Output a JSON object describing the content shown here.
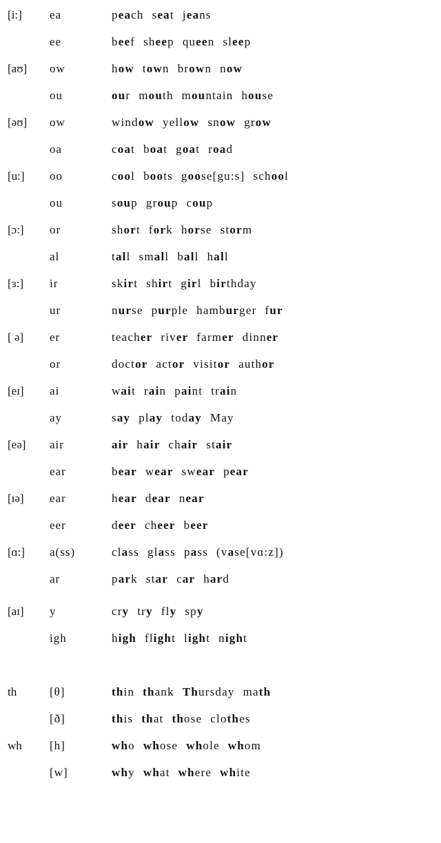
{
  "vowels": [
    {
      "ipa": "[i:]",
      "spelling": "ea",
      "bold": "ea",
      "words": [
        "peach",
        "seat",
        "jeans"
      ]
    },
    {
      "ipa": "",
      "spelling": "ee",
      "bold": "ee",
      "words": [
        "beef",
        "sheep",
        "queen",
        "sleep"
      ]
    },
    {
      "ipa": "[aʊ]",
      "spelling": "ow",
      "bold": "ow",
      "words": [
        "how",
        "town",
        "brown",
        "now"
      ]
    },
    {
      "ipa": "",
      "spelling": "ou",
      "bold": "ou",
      "words": [
        "our",
        "mouth",
        "mountain",
        "house"
      ]
    },
    {
      "ipa": "[əʊ]",
      "spelling": "ow",
      "bold": "ow",
      "words": [
        "window",
        "yellow",
        "snow",
        "grow"
      ]
    },
    {
      "ipa": "",
      "spelling": "oa",
      "bold": "oa",
      "words": [
        "coat",
        "boat",
        "goat",
        "road"
      ]
    },
    {
      "ipa": "[u:]",
      "spelling": "oo",
      "bold": "oo",
      "words": [
        "cool",
        "boots",
        "goose[gu:s]",
        "school"
      ]
    },
    {
      "ipa": "",
      "spelling": "ou",
      "bold": "ou",
      "words": [
        "soup",
        "group",
        "coup"
      ]
    },
    {
      "ipa": "[ɔ:]",
      "spelling": "or",
      "bold": "or",
      "words": [
        "short",
        "fork",
        "horse",
        "storm"
      ]
    },
    {
      "ipa": "",
      "spelling": "al",
      "bold": "al",
      "words": [
        "tall",
        "small",
        "ball",
        "hall"
      ]
    },
    {
      "ipa": "[ɜ:]",
      "spelling": "ir",
      "bold": "ir",
      "words": [
        "skirt",
        "shirt",
        "girl",
        "birthday"
      ]
    },
    {
      "ipa": "",
      "spelling": "ur",
      "bold": "ur",
      "words": [
        "nurse",
        "purple",
        "hamburger",
        "fur"
      ]
    },
    {
      "ipa": "[ ə]",
      "spelling": "er",
      "bold": "er",
      "words": [
        "teacher",
        "river",
        "farmer",
        "dinner"
      ]
    },
    {
      "ipa": "",
      "spelling": "or",
      "bold": "or",
      "words": [
        "doctor",
        "actor",
        "visitor",
        "author"
      ]
    },
    {
      "ipa": "[eɪ]",
      "spelling": "ai",
      "bold": "ai",
      "words": [
        "wait",
        "rain",
        "paint",
        "train"
      ]
    },
    {
      "ipa": "",
      "spelling": "ay",
      "bold": "ay",
      "words": [
        "say",
        "play",
        "today",
        "May"
      ]
    },
    {
      "ipa": "[eə]",
      "spelling": "air",
      "bold": "air",
      "words": [
        "air",
        "hair",
        "chair",
        "stair"
      ]
    },
    {
      "ipa": "",
      "spelling": "ear",
      "bold": "ear",
      "words": [
        "bear",
        "wear",
        "swear",
        "pear"
      ]
    },
    {
      "ipa": "[ɪə]",
      "spelling": "ear",
      "bold": "ear",
      "words": [
        "hear",
        "dear",
        "near"
      ]
    },
    {
      "ipa": "",
      "spelling": "eer",
      "bold": "eer",
      "words": [
        "deer",
        "cheer",
        "beer"
      ]
    },
    {
      "ipa": "[ɑ:]",
      "spelling": "a(ss)",
      "bold": "a",
      "words": [
        "class",
        "glass",
        "pass",
        "(vase[vɑ:z])"
      ]
    },
    {
      "ipa": "",
      "spelling": "ar",
      "bold": "ar",
      "words": [
        "park",
        "star",
        "car",
        "hard"
      ]
    },
    {
      "ipa": "[aɪ]",
      "spelling": "y",
      "bold": "y",
      "words": [
        "cry",
        "try",
        "fly",
        "spy"
      ]
    },
    {
      "ipa": "",
      "spelling": "igh",
      "bold": "igh",
      "words": [
        "high",
        "flight",
        "light",
        "night"
      ]
    }
  ],
  "consonants": [
    {
      "spelling": "th",
      "ipa": "[θ]",
      "bold": "th",
      "words": [
        "thin",
        "thank",
        "Thursday",
        "math"
      ]
    },
    {
      "spelling": "",
      "ipa": "[ð]",
      "bold": "th",
      "words": [
        "this",
        "that",
        "those",
        "clothes"
      ]
    },
    {
      "spelling": "wh",
      "ipa": "[h]",
      "bold": "wh",
      "words": [
        "who",
        "whose",
        "whole",
        "whom"
      ]
    },
    {
      "spelling": "",
      "ipa": "[w]",
      "bold": "wh",
      "words": [
        "why",
        "what",
        "where",
        "white"
      ]
    }
  ]
}
